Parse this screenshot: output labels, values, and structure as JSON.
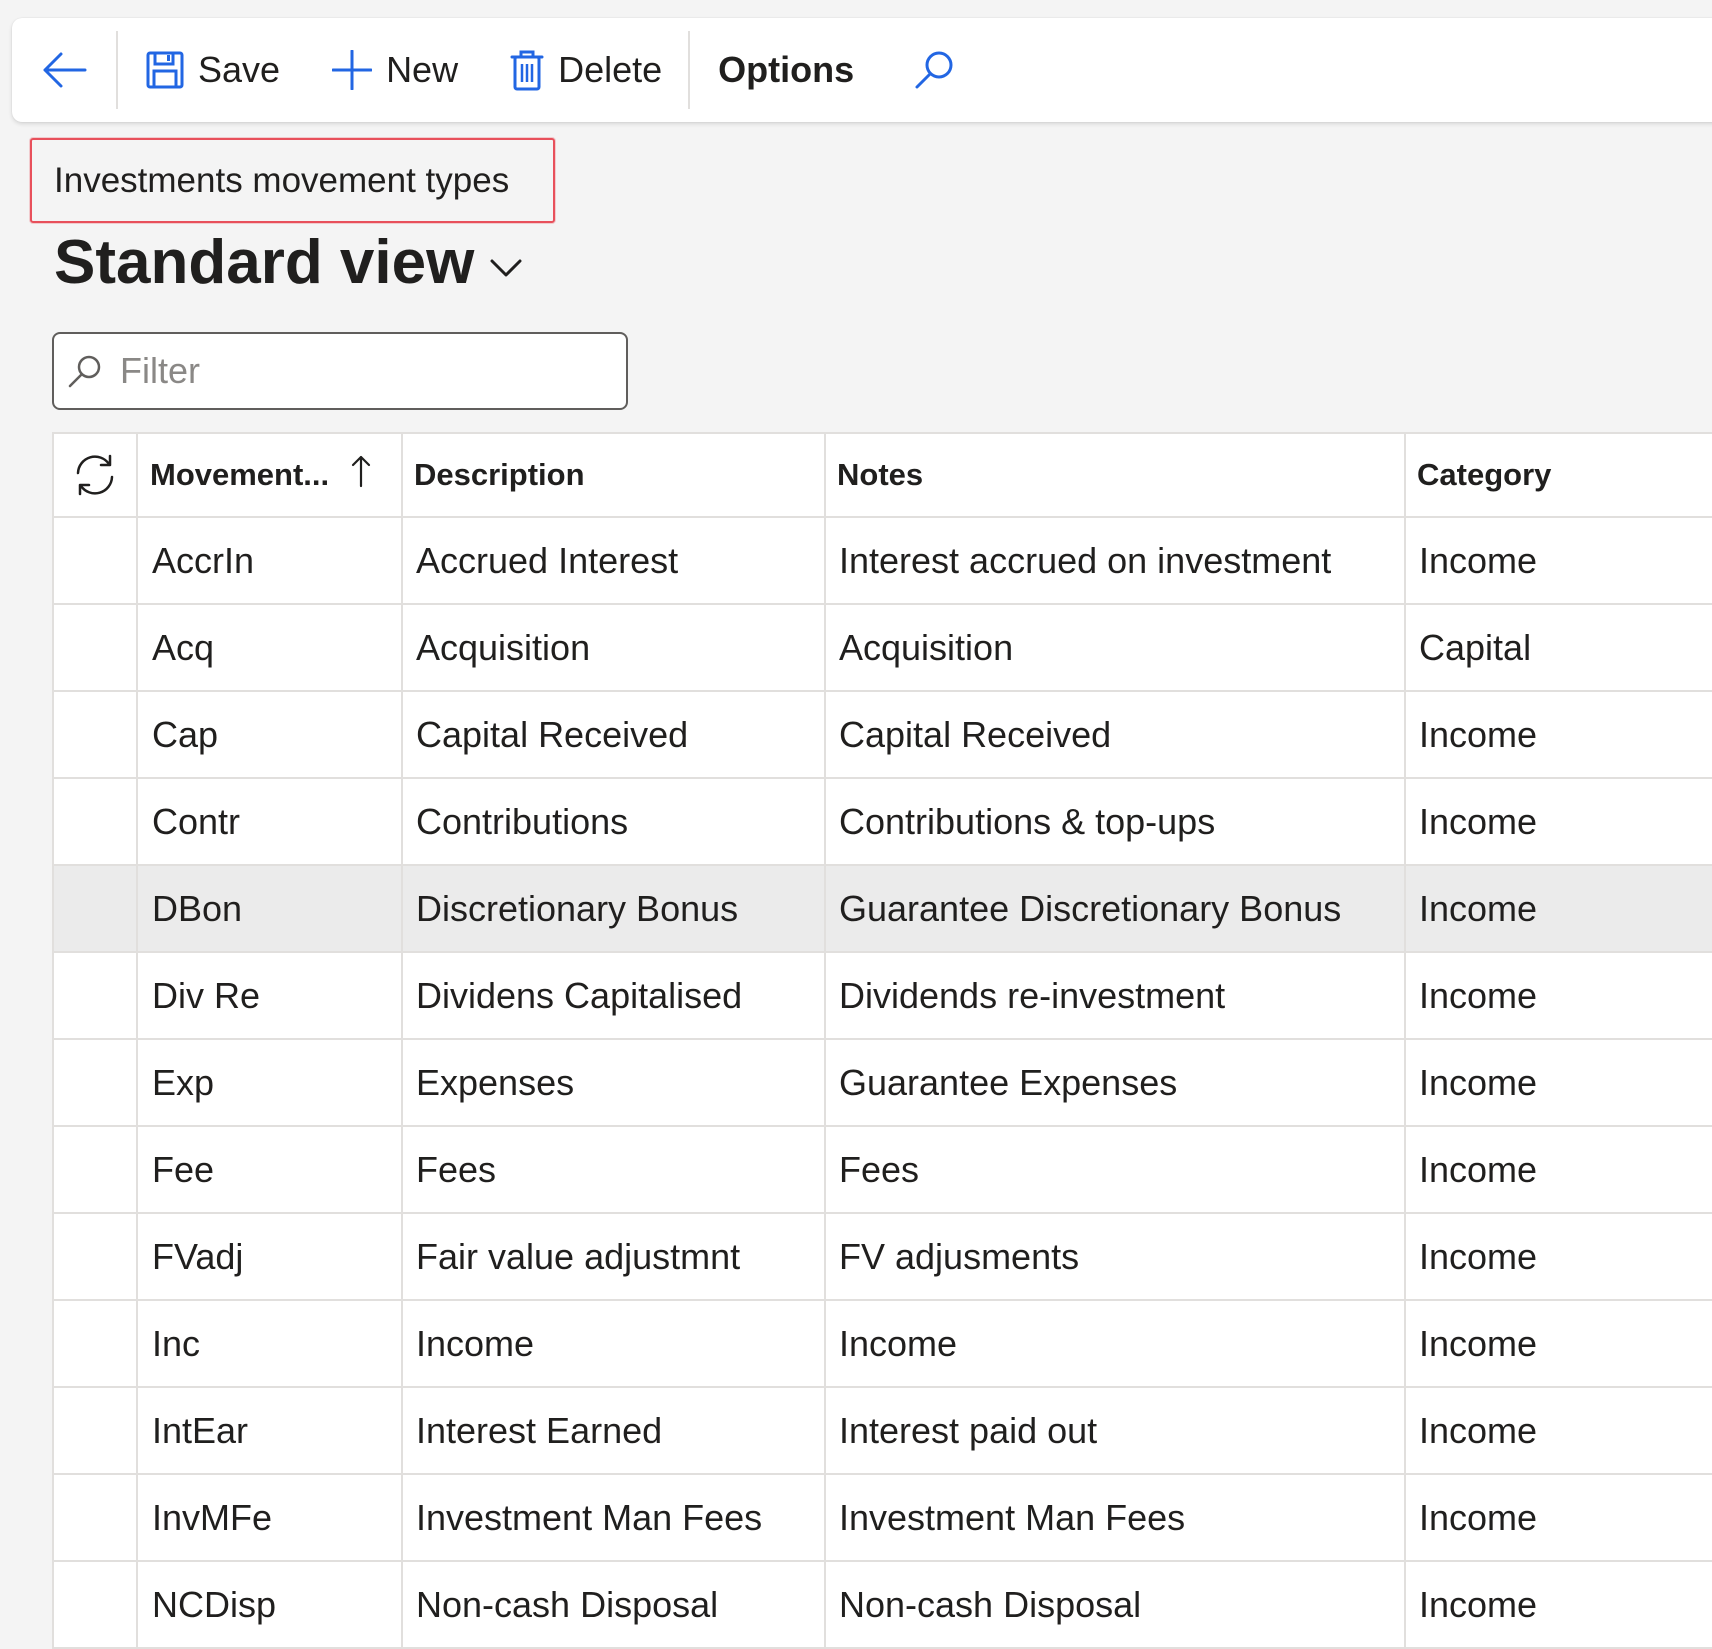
{
  "toolbar": {
    "save_label": "Save",
    "new_label": "New",
    "delete_label": "Delete",
    "options_label": "Options"
  },
  "page": {
    "caption": "Investments movement types",
    "view_title": "Standard view"
  },
  "filter": {
    "placeholder": "Filter",
    "value": ""
  },
  "grid": {
    "columns": [
      "Movement...",
      "Description",
      "Notes",
      "Category"
    ],
    "sort": {
      "column": "Movement...",
      "direction": "ascending"
    },
    "selected_row": 4,
    "rows": [
      {
        "movement": "AccrIn",
        "description": "Accrued Interest",
        "notes": "Interest accrued on investment",
        "category": "Income"
      },
      {
        "movement": "Acq",
        "description": "Acquisition",
        "notes": "Acquisition",
        "category": "Capital"
      },
      {
        "movement": "Cap",
        "description": "Capital Received",
        "notes": "Capital Received",
        "category": "Income"
      },
      {
        "movement": "Contr",
        "description": "Contributions",
        "notes": "Contributions & top-ups",
        "category": "Income"
      },
      {
        "movement": "DBon",
        "description": "Discretionary Bonus",
        "notes": "Guarantee Discretionary Bonus",
        "category": "Income"
      },
      {
        "movement": "Div Re",
        "description": "Dividens Capitalised",
        "notes": "Dividends re-investment",
        "category": "Income"
      },
      {
        "movement": "Exp",
        "description": "Expenses",
        "notes": "Guarantee Expenses",
        "category": "Income"
      },
      {
        "movement": "Fee",
        "description": "Fees",
        "notes": "Fees",
        "category": "Income"
      },
      {
        "movement": "FVadj",
        "description": "Fair value adjustmnt",
        "notes": "FV adjusments",
        "category": "Income"
      },
      {
        "movement": "Inc",
        "description": "Income",
        "notes": "Income",
        "category": "Income"
      },
      {
        "movement": "IntEar",
        "description": "Interest Earned",
        "notes": "Interest paid out",
        "category": "Income"
      },
      {
        "movement": "InvMFe",
        "description": "Investment Man Fees",
        "notes": "Investment Man Fees",
        "category": "Income"
      },
      {
        "movement": "NCDisp",
        "description": "Non-cash Disposal",
        "notes": "Non-cash Disposal",
        "category": "Income"
      }
    ]
  },
  "colors": {
    "accent": "#2266e3",
    "highlight_border": "#e8505b",
    "selected_row": "#ebebeb"
  },
  "icons": {
    "back": "arrow-left-icon",
    "save": "floppy-disk-icon",
    "new": "plus-icon",
    "delete": "trash-icon",
    "search": "search-icon",
    "refresh": "refresh-icon",
    "sort": "arrow-up-icon",
    "view_dropdown": "chevron-down-icon"
  }
}
